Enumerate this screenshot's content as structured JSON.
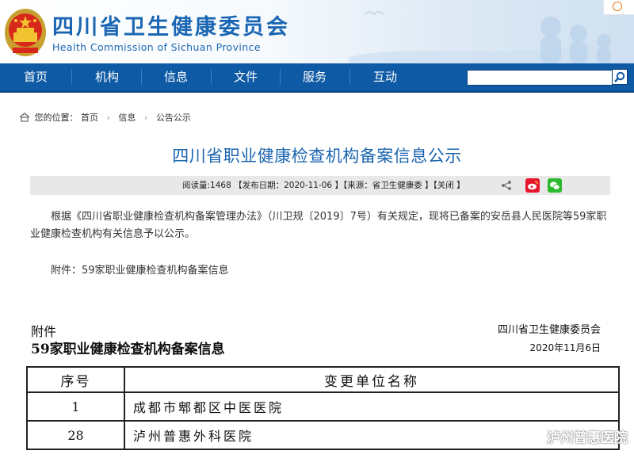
{
  "header": {
    "title_zh": "四川省卫生健康委员会",
    "title_en": "Health Commission of Sichuan Province"
  },
  "nav": {
    "items": [
      "首页",
      "机构",
      "信息",
      "文件",
      "服务",
      "互动"
    ],
    "search_value": "",
    "colors": {
      "bar": "#0f5aa5",
      "text": "#ffffff"
    }
  },
  "breadcrumb": {
    "prefix": "您的位置：",
    "items": [
      "首页",
      "信息",
      "公告公示"
    ]
  },
  "article": {
    "title": "四川省职业健康检查机构备案信息公示",
    "meta": "阅读量:1468 【发布日期：2020-11-06 】【来源：省卫生健康委 】【关闭 】",
    "para1": "根据《四川省职业健康检查机构备案管理办法》（川卫规〔2019〕7号）有关规定，现将已备案的安岳县人民医院等59家职业健康检查机构有关信息予以公示。",
    "para2": "附件：59家职业健康检查机构备案信息"
  },
  "attachment": {
    "label": "附件",
    "title": "59家职业健康检查机构备案信息",
    "org": "四川省卫生健康委员会",
    "date": "2020年11月6日"
  },
  "table": {
    "headers": [
      "序号",
      "变更单位名称"
    ],
    "rows": [
      {
        "no": "1",
        "name": "成都市郫都区中医医院"
      },
      {
        "no": "28",
        "name": "泸州普惠外科医院"
      }
    ]
  },
  "watermark": {
    "text": "泸州普惠医院"
  },
  "icons": {
    "emblem": "national-emblem-icon",
    "home": "home-icon",
    "search": "search-icon",
    "share": "share-icon",
    "weibo": "weibo-icon",
    "wechat": "wechat-icon"
  }
}
